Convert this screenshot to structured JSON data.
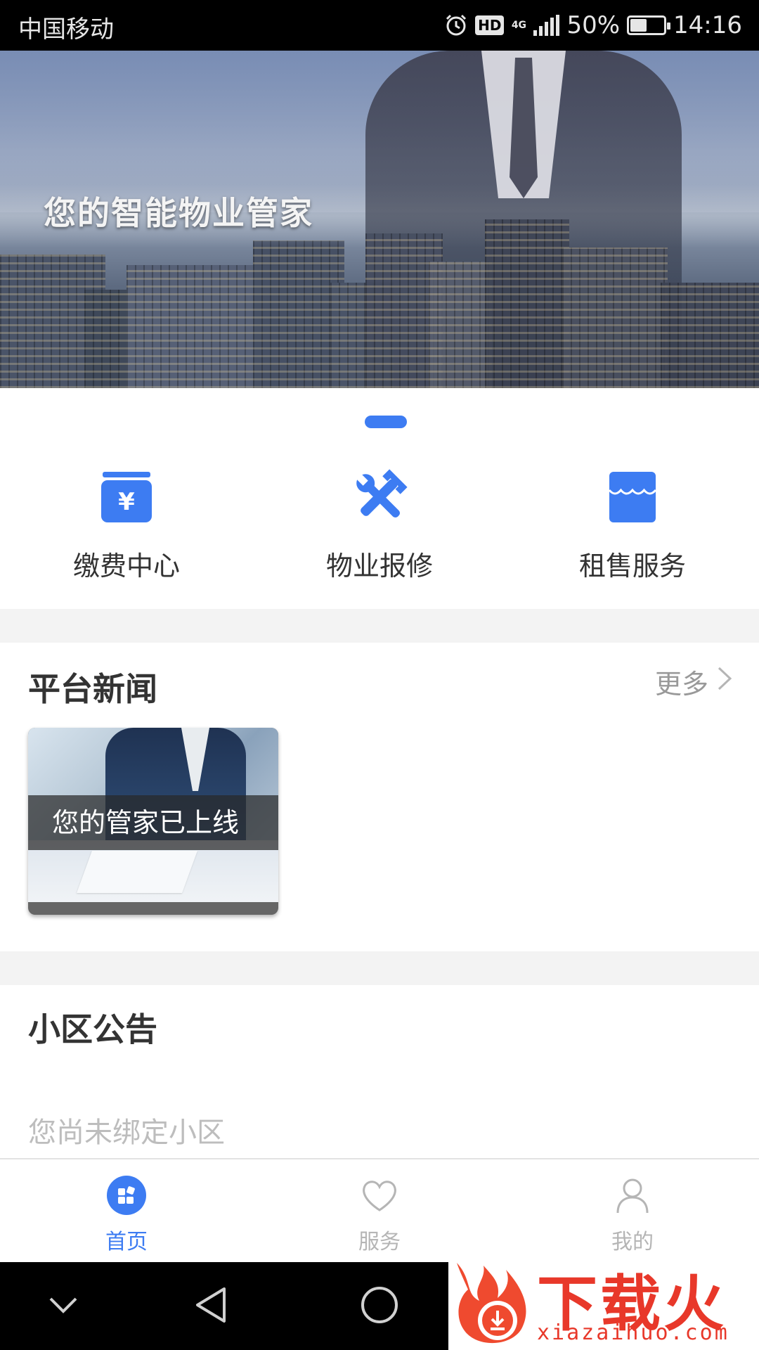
{
  "status_bar": {
    "carrier": "中国移动",
    "hd": "HD",
    "network": "4G",
    "battery": "50%",
    "battery_level": 0.5,
    "time": "14:16"
  },
  "banner": {
    "slogan": "您的智能物业管家",
    "page_count": 1,
    "active_index": 0
  },
  "quick_entries": [
    {
      "label": "缴费中心",
      "icon": "payment-icon"
    },
    {
      "label": "物业报修",
      "icon": "repair-icon"
    },
    {
      "label": "租售服务",
      "icon": "store-icon"
    }
  ],
  "news": {
    "title": "平台新闻",
    "more": "更多",
    "items": [
      {
        "caption": "您的管家已上线"
      }
    ]
  },
  "notice": {
    "title": "小区公告",
    "empty_text": "您尚未绑定小区"
  },
  "tabbar": {
    "items": [
      {
        "label": "首页",
        "icon": "home-icon",
        "active": true
      },
      {
        "label": "服务",
        "icon": "heart-icon",
        "active": false
      },
      {
        "label": "我的",
        "icon": "user-icon",
        "active": false
      }
    ]
  },
  "watermark": {
    "text": "下载火",
    "url": "xiazaihuo.com"
  },
  "colors": {
    "accent": "#3d7cf2",
    "inactive": "#b5b5b5",
    "divider": "#f3f3f3"
  }
}
